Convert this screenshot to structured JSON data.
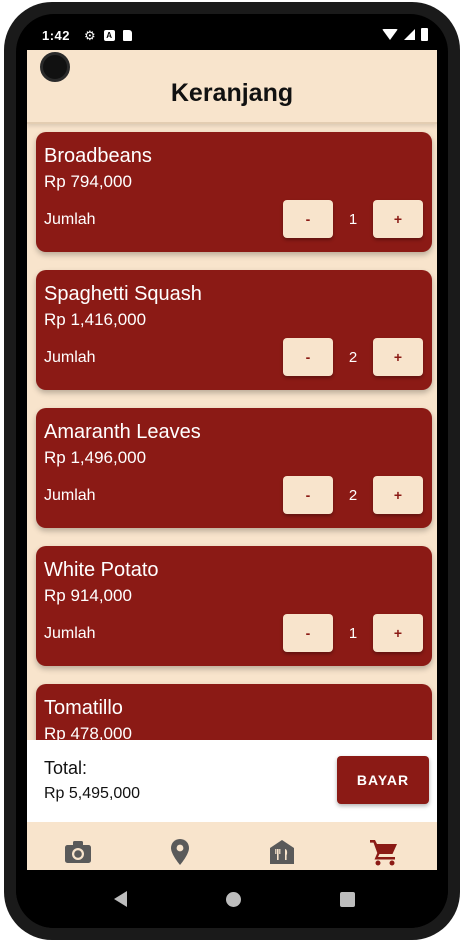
{
  "status": {
    "time": "1:42",
    "a_badge": "A"
  },
  "appbar": {
    "title": "Keranjang"
  },
  "cart": {
    "quantity_label": "Jumlah",
    "minus_label": "-",
    "plus_label": "+",
    "items": [
      {
        "name": "Broadbeans",
        "price": "Rp 794,000",
        "qty": "1"
      },
      {
        "name": "Spaghetti Squash",
        "price": "Rp 1,416,000",
        "qty": "2"
      },
      {
        "name": "Amaranth Leaves",
        "price": "Rp 1,496,000",
        "qty": "2"
      },
      {
        "name": "White Potato",
        "price": "Rp 914,000",
        "qty": "1"
      },
      {
        "name": "Tomatillo",
        "price": "Rp 478,000",
        "qty": ""
      }
    ]
  },
  "total": {
    "label": "Total:",
    "value": "Rp 5,495,000",
    "pay_label": "BAYAR"
  },
  "nav": {
    "items": [
      {
        "icon": "camera-icon",
        "active": false
      },
      {
        "icon": "location-pin-icon",
        "active": false
      },
      {
        "icon": "restaurant-icon",
        "active": false
      },
      {
        "icon": "cart-icon",
        "active": true
      }
    ]
  },
  "colors": {
    "primary": "#8b1a15",
    "background": "#f8e4cc",
    "nav_inactive": "#5a5a5a"
  }
}
